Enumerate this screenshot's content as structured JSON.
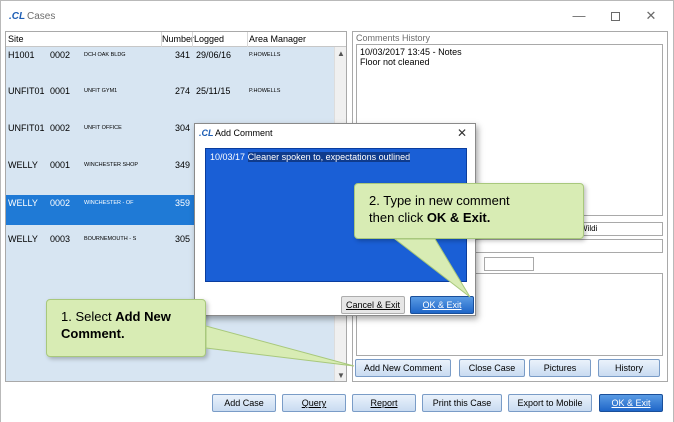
{
  "window": {
    "title": "Cases",
    "logo": ".CL"
  },
  "grid": {
    "headers": {
      "site": "Site",
      "number": "Number",
      "logged": "Logged",
      "area_manager": "Area Manager"
    },
    "rows": [
      {
        "site": "H1001",
        "code": "0002",
        "address": "DCH OAK BLDG",
        "number": "341",
        "logged": "29/06/16",
        "manager": "P.HOWELLS"
      },
      {
        "site": "UNFIT01",
        "code": "0001",
        "address": "UNFIT GYM1",
        "number": "274",
        "logged": "25/11/15",
        "manager": "P.HOWELLS"
      },
      {
        "site": "UNFIT01",
        "code": "0002",
        "address": "UNFIT OFFICE",
        "number": "304",
        "logged": "",
        "manager": ""
      },
      {
        "site": "WELLY",
        "code": "0001",
        "address": "WINCHESTER SHOP",
        "number": "349",
        "logged": "",
        "manager": ""
      },
      {
        "site": "WELLY",
        "code": "0002",
        "address": "WINCHESTER - OF",
        "number": "359",
        "logged": "",
        "manager": ""
      },
      {
        "site": "WELLY",
        "code": "0003",
        "address": "BOURNEMOUTH - S",
        "number": "305",
        "logged": "",
        "manager": ""
      }
    ],
    "selected_index": 4
  },
  "right_panel": {
    "comments_history_label": "Comments History",
    "comments_history_line1": "10/03/2017 13:45 - Notes",
    "comments_history_line2": "Floor not cleaned",
    "field1_value": "Wildi",
    "buttons": {
      "add_new_comment": "Add New Comment",
      "close_case": "Close Case",
      "pictures": "Pictures",
      "history": "History"
    }
  },
  "bottom_bar": {
    "add_case": "Add Case",
    "query": "Query",
    "report": "Report",
    "print_case": "Print this Case",
    "export_mobile": "Export to Mobile",
    "ok_exit": "OK & Exit"
  },
  "dialog": {
    "title": "Add Comment",
    "comment_date": "10/03/17",
    "comment_text": "Cleaner spoken to, expectations outlined",
    "cancel_exit": "Cancel & Exit",
    "ok_exit": "OK & Exit"
  },
  "callouts": {
    "step1_prefix": "1. Select ",
    "step1_bold": "Add New Comment.",
    "step2_line1": "2. Type in new comment",
    "step2_line2_prefix": "then click ",
    "step2_bold": "OK & Exit."
  },
  "colors": {
    "accent": "#1f7ad6",
    "grid_bg": "#d7e5f2",
    "callout_bg": "#d8ecb4"
  }
}
